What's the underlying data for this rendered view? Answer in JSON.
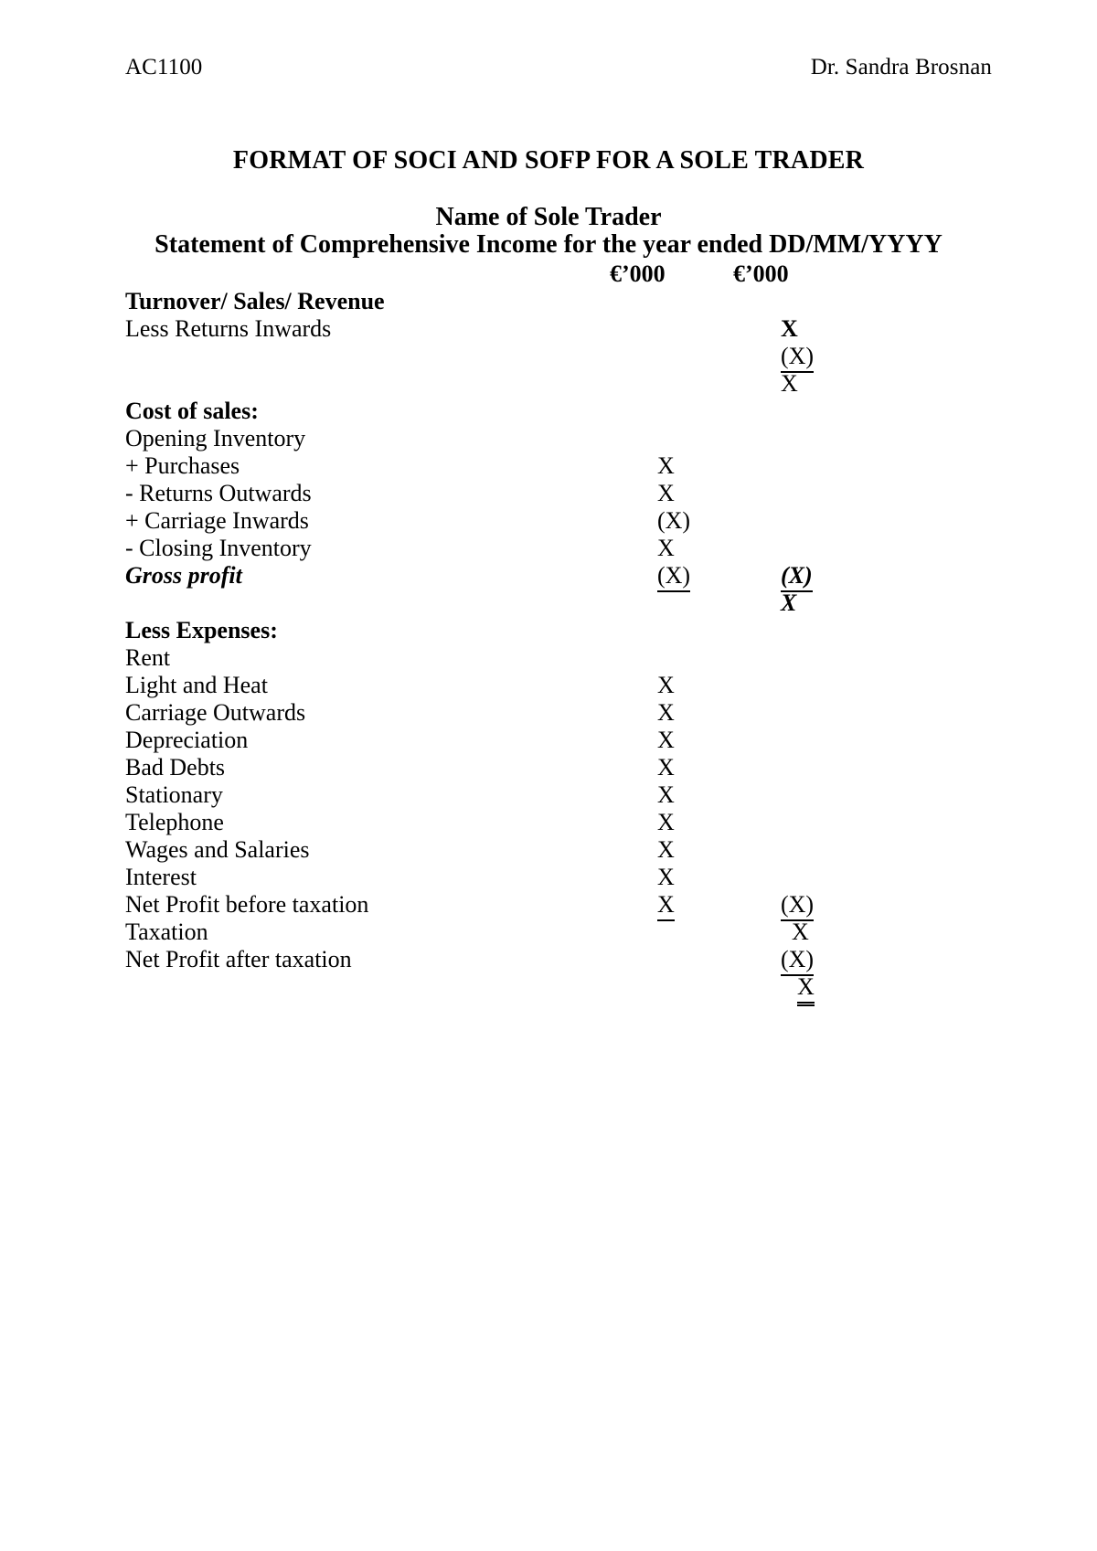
{
  "header": {
    "course_code": "AC1100",
    "author": "Dr. Sandra Brosnan"
  },
  "titles": {
    "main": "FORMAT OF SOCI AND SOFP FOR A SOLE TRADER",
    "entity": "Name of Sole Trader",
    "statement": "Statement of Comprehensive Income for the year ended DD/MM/YYYY"
  },
  "columns": {
    "col1_header": "€’000",
    "col2_header": "€’000"
  },
  "rows": {
    "turnover_label": "Turnover/ Sales/ Revenue",
    "turnover_col2": "X",
    "returns_inwards_label": "Less Returns Inwards",
    "returns_inwards_col2": "(X)",
    "net_sales_col2": "X",
    "cost_of_sales_label": "Cost of sales:",
    "opening_inventory_label": "Opening Inventory",
    "opening_inventory_col1": "X",
    "purchases_label": "+ Purchases",
    "purchases_col1": "X",
    "returns_outwards_label": "- Returns Outwards",
    "returns_outwards_col1": "(X)",
    "carriage_inwards_label": "+ Carriage Inwards",
    "carriage_inwards_col1": "X",
    "closing_inventory_label": "- Closing Inventory",
    "closing_inventory_col1": "(X)",
    "closing_inventory_col2": "(X)",
    "gross_profit_label": "Gross profit",
    "gross_profit_col2": "X",
    "less_expenses_label": "Less Expenses:",
    "rent_label": "Rent",
    "rent_col1": "X",
    "light_heat_label": "Light and Heat",
    "light_heat_col1": "X",
    "carriage_outwards_label": "Carriage Outwards",
    "carriage_outwards_col1": "X",
    "depreciation_label": "Depreciation",
    "depreciation_col1": "X",
    "bad_debts_label": "Bad Debts",
    "bad_debts_col1": "X",
    "stationary_label": "Stationary",
    "stationary_col1": "X",
    "telephone_label": "Telephone",
    "telephone_col1": "X",
    "wages_salaries_label": "Wages and Salaries",
    "wages_salaries_col1": "X",
    "interest_label": "Interest",
    "interest_col1": "X",
    "interest_col2": "(X)",
    "npbt_label": "Net Profit before taxation",
    "npbt_col2": "X",
    "taxation_label": "Taxation",
    "taxation_col2": "(X)",
    "npat_label": "Net Profit after taxation",
    "npat_col2": "X"
  }
}
